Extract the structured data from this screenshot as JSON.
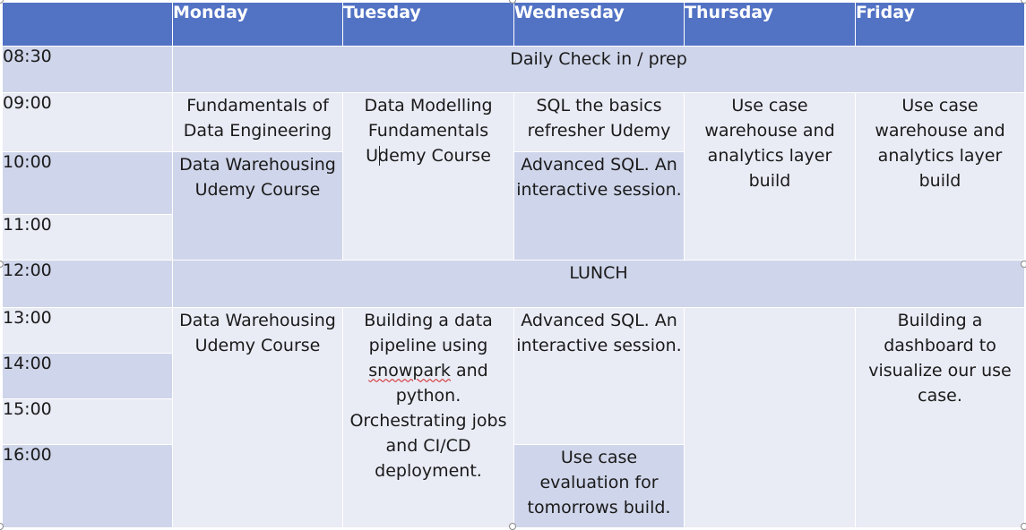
{
  "days": [
    "Monday",
    "Tuesday",
    "Wednesday",
    "Thursday",
    "Friday"
  ],
  "times": [
    "08:30",
    "09:00",
    "10:00",
    "11:00",
    "12:00",
    "13:00",
    "14:00",
    "15:00",
    "16:00"
  ],
  "sessions": {
    "daily_checkin": "Daily Check in / prep",
    "lunch": "LUNCH",
    "mon_am_1": "Fundamentals of Data Engineering",
    "mon_am_2": "Data Warehousing Udemy Course",
    "tue_am_a": "Data Modelling Fundamentals U",
    "tue_am_b": "demy Course",
    "wed_am_1": "SQL the basics refresher Udemy",
    "wed_am_2": "Advanced SQL. An interactive session.",
    "thu_am": "Use case warehouse and analytics layer build",
    "fri_am": "Use case warehouse and analytics layer build",
    "mon_pm": "Data Warehousing Udemy Course",
    "tue_pm_a": "Building a data pipeline using ",
    "tue_pm_word": "snowpark",
    "tue_pm_b": " and python. Orchestrating jobs and CI/CD deployment.",
    "wed_pm_1": "Advanced SQL. An interactive session.",
    "wed_pm_2": "Use case evaluation for tomorrows build.",
    "thu_pm": "",
    "fri_pm": "Building a dashboard to visualize our use case."
  },
  "colors": {
    "header": "#5272c4",
    "band_dark": "#cfd5ea",
    "band_light": "#e9ebf5",
    "text": "#1a1a1a",
    "spell_underline": "#d02020"
  }
}
